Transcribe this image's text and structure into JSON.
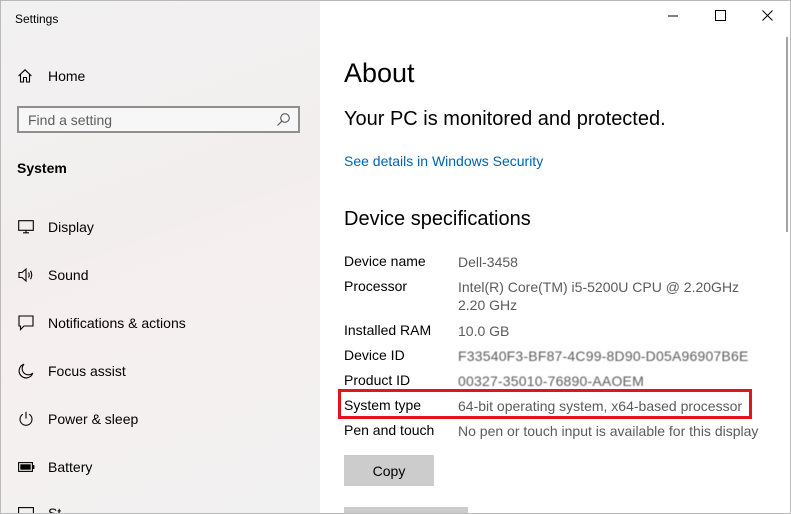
{
  "window": {
    "title": "Settings"
  },
  "sidebar": {
    "home_label": "Home",
    "search_placeholder": "Find a setting",
    "section": "System",
    "items": [
      {
        "label": "Display",
        "icon": "display-icon"
      },
      {
        "label": "Sound",
        "icon": "speaker-icon"
      },
      {
        "label": "Notifications & actions",
        "icon": "notification-icon"
      },
      {
        "label": "Focus assist",
        "icon": "moon-icon"
      },
      {
        "label": "Power & sleep",
        "icon": "power-icon"
      },
      {
        "label": "Battery",
        "icon": "battery-icon"
      },
      {
        "label": "St",
        "icon": "storage-icon"
      }
    ]
  },
  "main": {
    "title": "About",
    "protection_status": "Your PC is monitored and protected.",
    "security_link": "See details in Windows Security",
    "specs_title": "Device specifications",
    "specs": [
      {
        "label": "Device name",
        "value": "Dell-3458"
      },
      {
        "label": "Processor",
        "value": "Intel(R) Core(TM) i5-5200U CPU @ 2.20GHz   2.20 GHz"
      },
      {
        "label": "Installed RAM",
        "value": "10.0 GB"
      },
      {
        "label": "Device ID",
        "value": "F33540F3-BF87-4C99-8D90-D05A96907B6E"
      },
      {
        "label": "Product ID",
        "value": "00327-35010-76890-AAOEM"
      },
      {
        "label": "System type",
        "value": "64-bit operating system, x64-based processor"
      },
      {
        "label": "Pen and touch",
        "value": "No pen or touch input is available for this display"
      }
    ],
    "copy_label": "Copy"
  },
  "colors": {
    "link": "#0063b1",
    "highlight_border": "#e3141e",
    "button_bg": "#cccccc",
    "sidebar_bg": "#f1f1f1"
  }
}
